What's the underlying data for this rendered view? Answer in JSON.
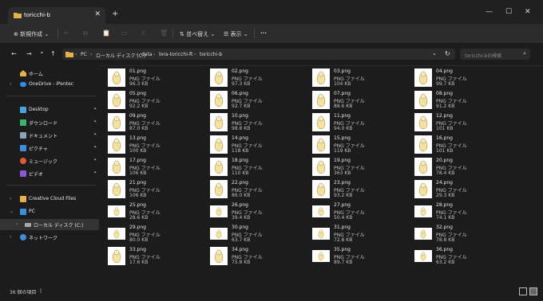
{
  "window": {
    "tab_title": "toricchi-b",
    "tab_close": "✕",
    "new_tab": "+",
    "minimize": "—",
    "maximize": "☐",
    "close": "✕"
  },
  "toolbar": {
    "new_label": "新規作成",
    "sort_label": "並べ替え",
    "view_label": "表示",
    "more_label": "···"
  },
  "nav": {
    "back": "←",
    "forward": "→",
    "history": "⌄",
    "up": "↑",
    "breadcrumb": [
      "PC",
      "ローカル ディスク (C:)",
      "data",
      "lora-toricchi-ft",
      "toricchi-b"
    ],
    "refresh": "↻",
    "search_placeholder": "toricchi-bの検索"
  },
  "sidebar": {
    "items": [
      {
        "label": "ホーム",
        "icon": "home-icon",
        "color": "#e8b04a",
        "chev": ""
      },
      {
        "label": "OneDrive - iPentec",
        "icon": "cloud-icon",
        "color": "#2f8ee5",
        "chev": "›"
      },
      {
        "label": "Desktop",
        "icon": "desktop-icon",
        "color": "#4aa0e0",
        "chev": "",
        "pin": true
      },
      {
        "label": "ダウンロード",
        "icon": "download-icon",
        "color": "#3bb36a",
        "chev": "",
        "pin": true
      },
      {
        "label": "ドキュメント",
        "icon": "document-icon",
        "color": "#8aa4c0",
        "chev": "",
        "pin": true
      },
      {
        "label": "ピクチャ",
        "icon": "pictures-icon",
        "color": "#3a8fd6",
        "chev": "",
        "pin": true
      },
      {
        "label": "ミュージック",
        "icon": "music-icon",
        "color": "#e05a3a",
        "chev": "",
        "pin": true
      },
      {
        "label": "ビデオ",
        "icon": "video-icon",
        "color": "#8a5ad6",
        "chev": "",
        "pin": true
      },
      {
        "label": "Creative Cloud Files",
        "icon": "creative-cloud-icon",
        "color": "#e8b04a",
        "chev": "›"
      },
      {
        "label": "PC",
        "icon": "pc-icon",
        "color": "#3a8fd6",
        "chev": "⌄"
      },
      {
        "label": "ローカル ディスク (C:)",
        "icon": "disk-icon",
        "color": "#aaaaaa",
        "chev": "›"
      },
      {
        "label": "ネットワーク",
        "icon": "network-icon",
        "color": "#3a8fd6",
        "chev": "›"
      }
    ],
    "pin_glyph": "📌"
  },
  "files": [
    {
      "name": "01.png",
      "type": "PNG ファイル",
      "size": "96.3 KB"
    },
    {
      "name": "02.png",
      "type": "PNG ファイル",
      "size": "97.3 KB"
    },
    {
      "name": "03.png",
      "type": "PNG ファイル",
      "size": "104 KB"
    },
    {
      "name": "04.png",
      "type": "PNG ファイル",
      "size": "99.7 KB"
    },
    {
      "name": "05.png",
      "type": "PNG ファイル",
      "size": "92.2 KB"
    },
    {
      "name": "06.png",
      "type": "PNG ファイル",
      "size": "92.7 KB"
    },
    {
      "name": "07.png",
      "type": "PNG ファイル",
      "size": "88.6 KB"
    },
    {
      "name": "08.png",
      "type": "PNG ファイル",
      "size": "91.2 KB"
    },
    {
      "name": "09.png",
      "type": "PNG ファイル",
      "size": "87.0 KB"
    },
    {
      "name": "10.png",
      "type": "PNG ファイル",
      "size": "98.8 KB"
    },
    {
      "name": "11.png",
      "type": "PNG ファイル",
      "size": "94.0 KB"
    },
    {
      "name": "12.png",
      "type": "PNG ファイル",
      "size": "101 KB"
    },
    {
      "name": "13.png",
      "type": "PNG ファイル",
      "size": "100 KB"
    },
    {
      "name": "14.png",
      "type": "PNG ファイル",
      "size": "118 KB"
    },
    {
      "name": "15.png",
      "type": "PNG ファイル",
      "size": "119 KB"
    },
    {
      "name": "16.png",
      "type": "PNG ファイル",
      "size": "101 KB"
    },
    {
      "name": "17.png",
      "type": "PNG ファイル",
      "size": "106 KB"
    },
    {
      "name": "18.png",
      "type": "PNG ファイル",
      "size": "110 KB"
    },
    {
      "name": "19.png",
      "type": "PNG ファイル",
      "size": "363 KB"
    },
    {
      "name": "20.png",
      "type": "PNG ファイル",
      "size": "78.4 KB"
    },
    {
      "name": "21.png",
      "type": "PNG ファイル",
      "size": "106 KB"
    },
    {
      "name": "22.png",
      "type": "PNG ファイル",
      "size": "86.0 KB"
    },
    {
      "name": "23.png",
      "type": "PNG ファイル",
      "size": "93.2 KB"
    },
    {
      "name": "24.png",
      "type": "PNG ファイル",
      "size": "29.3 KB"
    },
    {
      "name": "25.png",
      "type": "PNG ファイル",
      "size": "28.6 KB"
    },
    {
      "name": "26.png",
      "type": "PNG ファイル",
      "size": "39.4 KB"
    },
    {
      "name": "27.png",
      "type": "PNG ファイル",
      "size": "50.4 KB"
    },
    {
      "name": "28.png",
      "type": "PNG ファイル",
      "size": "74.1 KB"
    },
    {
      "name": "29.png",
      "type": "PNG ファイル",
      "size": "80.0 KB"
    },
    {
      "name": "30.png",
      "type": "PNG ファイル",
      "size": "63.7 KB"
    },
    {
      "name": "31.png",
      "type": "PNG ファイル",
      "size": "72.8 KB"
    },
    {
      "name": "32.png",
      "type": "PNG ファイル",
      "size": "78.8 KB"
    },
    {
      "name": "33.png",
      "type": "PNG ファイル",
      "size": "17.6 KB"
    },
    {
      "name": "34.png",
      "type": "PNG ファイル",
      "size": "75.8 KB"
    },
    {
      "name": "35.png",
      "type": "PNG ファイル",
      "size": "89.7 KB"
    },
    {
      "name": "36.png",
      "type": "PNG ファイル",
      "size": "63.2 KB"
    }
  ],
  "status": {
    "item_count": "36 個の項目"
  }
}
